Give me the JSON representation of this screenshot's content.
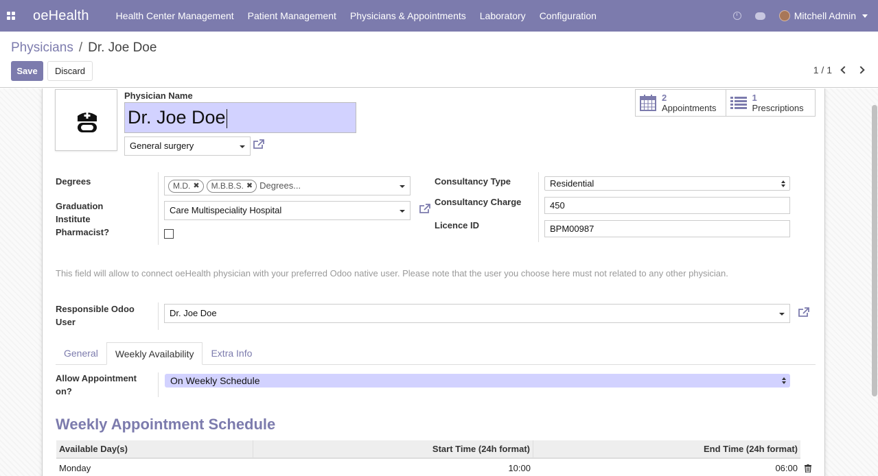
{
  "app": {
    "brand": "oeHealth",
    "menu": [
      "Health Center Management",
      "Patient Management",
      "Physicians & Appointments",
      "Laboratory",
      "Configuration"
    ],
    "user": "Mitchell Admin"
  },
  "control_panel": {
    "breadcrumb_parent": "Physicians",
    "breadcrumb_sep": "/",
    "breadcrumb_current": "Dr. Joe Doe",
    "save_label": "Save",
    "discard_label": "Discard",
    "pager": "1 / 1"
  },
  "form": {
    "physician_name_label": "Physician Name",
    "physician_name": "Dr. Joe Doe",
    "speciality": "General surgery",
    "smart_buttons": [
      {
        "count": "2",
        "label": "Appointments"
      },
      {
        "count": "1",
        "label": "Prescriptions"
      }
    ],
    "degrees_label": "Degrees",
    "degree_tags": [
      "M.D.",
      "M.B.B.S."
    ],
    "degrees_placeholder": "Degrees...",
    "graduation_label": "Graduation Institute",
    "graduation_value": "Care Multispeciality Hospital",
    "pharmacist_label": "Pharmacist?",
    "pharmacist_checked": false,
    "consultancy_type_label": "Consultancy Type",
    "consultancy_type_value": "Residential",
    "consultancy_charge_label": "Consultancy Charge",
    "consultancy_charge_value": "450",
    "licence_label": "Licence ID",
    "licence_value": "BPM00987",
    "help_text": "This field will allow to connect oeHealth physician with your preferred Odoo native user. Please note that the user you choose here must not related to any other physician.",
    "responsible_label": "Responsible Odoo User",
    "responsible_value": "Dr. Joe Doe"
  },
  "tabs": [
    "General",
    "Weekly Availability",
    "Extra Info"
  ],
  "active_tab": "Weekly Availability",
  "availability": {
    "allow_label": "Allow Appointment on?",
    "allow_value": "On Weekly Schedule",
    "section_title": "Weekly Appointment Schedule",
    "columns": [
      "Available Day(s)",
      "Start Time (24h format)",
      "End Time (24h format)"
    ],
    "rows": [
      {
        "day": "Monday",
        "start": "10:00",
        "end": "06:00"
      }
    ]
  },
  "colors": {
    "primary": "#7c7bad",
    "input_highlight": "#d2d2ff"
  }
}
